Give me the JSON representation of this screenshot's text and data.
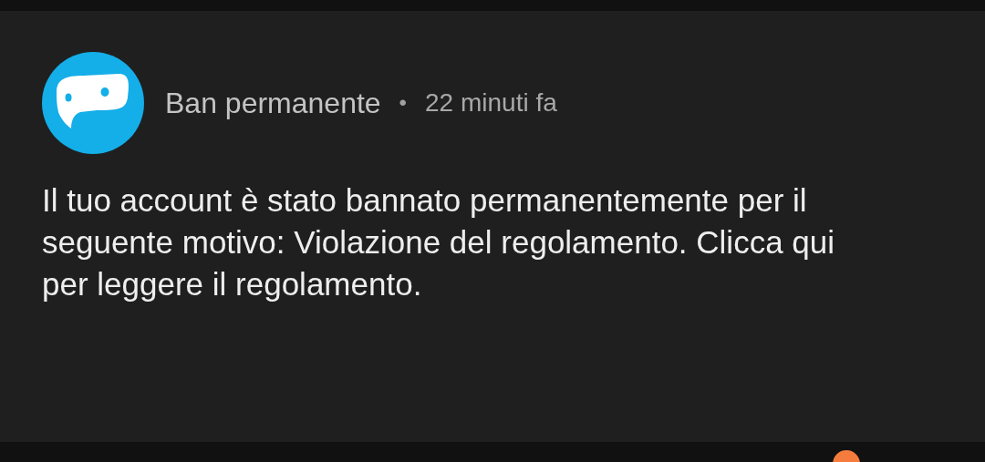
{
  "notification": {
    "title": "Ban permanente",
    "separator": "•",
    "time": "22 minuti fa",
    "message": "Il tuo account è stato bannato permanentemente per il seguente motivo: Violazione del regolamento. Clicca qui per leggere il regolamento."
  }
}
